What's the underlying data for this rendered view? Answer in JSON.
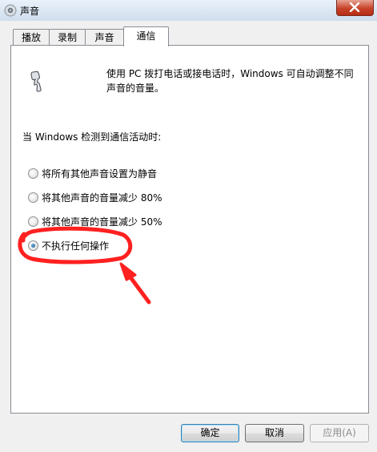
{
  "window": {
    "title": "声音",
    "app_icon": "speaker-icon",
    "close_icon": "close-icon",
    "close_color": "#c7432a"
  },
  "tabs": [
    {
      "label": "播放"
    },
    {
      "label": "录制"
    },
    {
      "label": "声音"
    },
    {
      "label": "通信",
      "active": true
    }
  ],
  "communications": {
    "icon": "phone-icon",
    "description": "使用 PC 拨打电话或接电话时，Windows 可自动调整不同声音的音量。",
    "section_label": "当 Windows 检测到通信活动时:",
    "options": [
      {
        "label": "将所有其他声音设置为静音",
        "checked": false
      },
      {
        "label": "将其他声音的音量减少 80%",
        "checked": false
      },
      {
        "label": "将其他声音的音量减少 50%",
        "checked": false
      },
      {
        "label": "不执行任何操作",
        "checked": true
      }
    ]
  },
  "buttons": {
    "ok": "确定",
    "cancel": "取消",
    "apply": "应用(A)"
  },
  "annotation": {
    "color": "#ff2020"
  }
}
